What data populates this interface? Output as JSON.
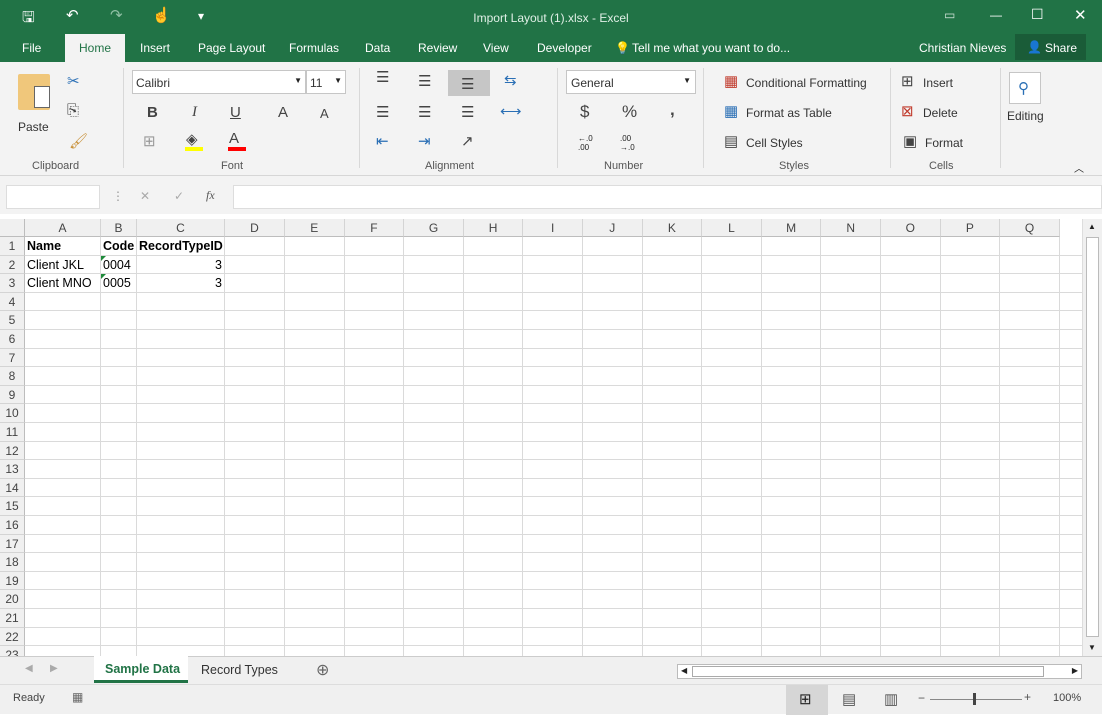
{
  "window": {
    "title": "Import Layout (1).xlsx - Excel"
  },
  "qat": {
    "save": "save-icon",
    "undo": "undo-icon",
    "redo": "redo-icon",
    "touch": "touch-mode-icon",
    "customize": "▾"
  },
  "menu": {
    "tabs": [
      "File",
      "Home",
      "Insert",
      "Page Layout",
      "Formulas",
      "Data",
      "Review",
      "View",
      "Developer"
    ],
    "active": "Home",
    "tell_me": "Tell me what you want to do...",
    "user": "Christian Nieves",
    "share": "Share"
  },
  "ribbon": {
    "clipboard": {
      "label": "Clipboard",
      "paste": "Paste"
    },
    "font": {
      "label": "Font",
      "name": "Calibri",
      "size": "11",
      "bold": "B",
      "italic": "I",
      "underline": "U",
      "grow": "A",
      "shrink": "A",
      "color_fill": "#ffff00",
      "color_font": "#ff0000"
    },
    "alignment": {
      "label": "Alignment"
    },
    "number": {
      "label": "Number",
      "format": "General",
      "currency": "$",
      "percent": "%",
      "comma": ",",
      "inc": "←.0 .00",
      "dec": ".00 →.0"
    },
    "styles": {
      "label": "Styles",
      "conditional": "Conditional Formatting",
      "table": "Format as Table",
      "cell_styles": "Cell Styles"
    },
    "cells": {
      "label": "Cells",
      "insert": "Insert",
      "delete": "Delete",
      "format": "Format"
    },
    "editing": {
      "label": "Editing"
    }
  },
  "formula_bar": {
    "name_box": "",
    "cancel": "✕",
    "enter": "✓",
    "fx": "fx",
    "value": ""
  },
  "sheet": {
    "columns": [
      "A",
      "B",
      "C",
      "D",
      "E",
      "F",
      "G",
      "H",
      "I",
      "J",
      "K",
      "L",
      "M",
      "N",
      "O",
      "P",
      "Q"
    ],
    "rows": [
      "1",
      "2",
      "3",
      "4",
      "5",
      "6",
      "7",
      "8",
      "9",
      "10",
      "11",
      "12",
      "13",
      "14",
      "15",
      "16",
      "17",
      "18",
      "19",
      "20",
      "21",
      "22",
      "23"
    ],
    "cells": [
      [
        "Name",
        "Code",
        "RecordTypeID"
      ],
      [
        "Client JKL",
        "0004",
        "3"
      ],
      [
        "Client  MNO",
        "0005",
        "3"
      ]
    ]
  },
  "sheet_tabs": {
    "tabs": [
      "Sample Data",
      "Record Types"
    ],
    "active": "Sample Data"
  },
  "status": {
    "ready": "Ready",
    "zoom": "100%",
    "zoom_minus": "−",
    "zoom_plus": "+"
  }
}
